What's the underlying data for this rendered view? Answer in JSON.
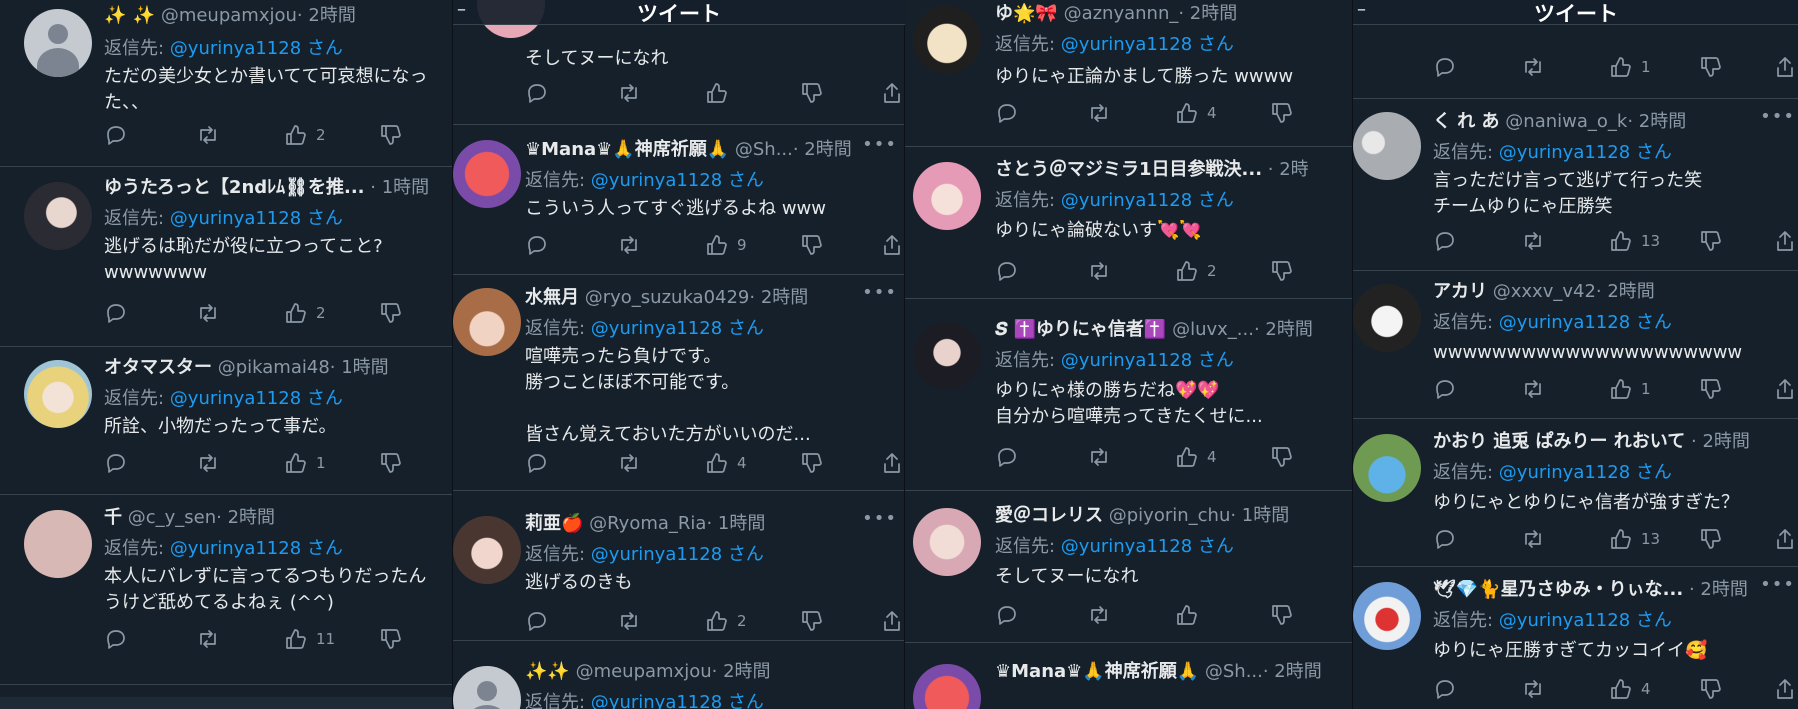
{
  "tweet_title": "ツイート",
  "back_glyph": "–",
  "colors": {
    "bg": "#15202b",
    "text": "#e7e9ea",
    "muted": "#8b98a5",
    "mention": "#1d9bf0",
    "divider": "#38444d"
  },
  "columns": [
    {
      "tweets": [
        {
          "name": "✨ ✨",
          "handle": "@meupamxjou",
          "time": "· 2時間",
          "reply_prefix": "返信先: ",
          "mention": "@yurinya1128 さん",
          "text": "ただの美少女とか書いてて可哀想になっ\nた、、",
          "likes": "2",
          "avatar": "default-avatar-icon"
        },
        {
          "name": "ゆうたろっと【2ndﾚﾑ⛓を推...",
          "handle": "",
          "time": "· 1時間",
          "reply_prefix": "返信先: ",
          "mention": "@yurinya1128 さん",
          "text": "逃げるは恥だが役に立つってこと?\nwwwwwww",
          "likes": "2",
          "avatar": "dark-hair-avatar"
        },
        {
          "name": "オタマスター",
          "handle": "@pikamai48",
          "time": "· 1時間",
          "reply_prefix": "返信先: ",
          "mention": "@yurinya1128 さん",
          "text": "所詮、小物だったって事だ。",
          "likes": "1",
          "avatar": "blonde-anime-avatar"
        },
        {
          "name": "千",
          "handle": "@c_y_sen",
          "time": "· 2時間",
          "reply_prefix": "返信先: ",
          "mention": "@yurinya1128 さん",
          "text": "本人にバレずに言ってるつもりだったん\nうけど舐めてるよねぇ (^^)",
          "likes": "11",
          "avatar": "pink-blank-avatar"
        }
      ]
    },
    {
      "tweets": [
        {
          "text": "そしてヌーになれ",
          "likes": "",
          "avatar": "pink-avatar"
        },
        {
          "name": "♛Mana♛🙏神席祈願🙏",
          "handle": "@Sh...",
          "time": "· 2時間",
          "reply_prefix": "返信先: ",
          "mention": "@yurinya1128 さん",
          "text": "こういう人ってすぐ逃げるよね www",
          "likes": "9",
          "avatar": "red-round-avatar"
        },
        {
          "name": "水無月",
          "handle": "@ryo_suzuka0429",
          "time": "· 2時間",
          "reply_prefix": "返信先: ",
          "mention": "@yurinya1128 さん",
          "text": "喧嘩売ったら負けです。\n勝つことほぼ不可能です。\n\n皆さん覚えておいた方がいいのだ...",
          "likes": "4",
          "avatar": "anime-girl-avatar"
        },
        {
          "name": "莉亜🍎",
          "handle": "@Ryoma_Ria",
          "time": "· 1時間",
          "reply_prefix": "返信先: ",
          "mention": "@yurinya1128 さん",
          "text": "逃げるのきも",
          "likes": "2",
          "avatar": "selfie-avatar"
        },
        {
          "name": "✨✨",
          "handle": "@meupamxjou",
          "time": "· 2時間",
          "reply_prefix": "返信先: ",
          "mention": "@yurinya1128 さん",
          "text": "",
          "likes": "",
          "avatar": "default-avatar-icon"
        }
      ]
    },
    {
      "tweets": [
        {
          "name": "ゆ🌟🎀",
          "handle": "@aznyannn_",
          "time": "· 2時間",
          "reply_prefix": "返信先: ",
          "mention": "@yurinya1128 さん",
          "text": "ゆりにゃ正論かまして勝った wwww",
          "likes": "4",
          "avatar": "chibi-avatar"
        },
        {
          "name": "さとう＠マジミラ1日目参戦決...",
          "handle": "",
          "time": "· 2時",
          "reply_prefix": "返信先: ",
          "mention": "@yurinya1128 さん",
          "text": "ゆりにゃ論破ないす💘💘",
          "likes": "2",
          "avatar": "pink-hair-avatar"
        },
        {
          "name": "𝑺 ✝️ゆりにゃ信者✝️",
          "handle": "@luvx_...",
          "time": "· 2時間",
          "reply_prefix": "返信先: ",
          "mention": "@yurinya1128 さん",
          "text": "ゆりにゃ様の勝ちだね💖💖\n自分から喧嘩売ってきたくせに...",
          "likes": "4",
          "avatar": "photo-avatar"
        },
        {
          "name": "愛＠コレリス",
          "handle": "@piyorin_chu",
          "time": "· 1時間",
          "reply_prefix": "返信先: ",
          "mention": "@yurinya1128 さん",
          "text": "そしてヌーになれ",
          "likes": "",
          "avatar": "pastel-avatar"
        },
        {
          "name": "♛Mana♛🙏神席祈願🙏",
          "handle": "@Sh...",
          "time": "· 2時間",
          "reply_prefix": "",
          "mention": "",
          "text": "",
          "likes": "",
          "avatar": "red-round-avatar"
        }
      ]
    },
    {
      "tweets": [
        {
          "text": "",
          "likes": "1",
          "avatar": ""
        },
        {
          "name": "く れ あ",
          "handle": "@naniwa_o_k",
          "time": "· 2時間",
          "reply_prefix": "返信先: ",
          "mention": "@yurinya1128 さん",
          "text": "言っただけ言って逃げて行った笑\nチームゆりにゃ圧勝笑",
          "likes": "13",
          "avatar": "gray-avatar"
        },
        {
          "name": "アカリ",
          "handle": "@xxxv_v42",
          "time": "· 2時間",
          "reply_prefix": "返信先: ",
          "mention": "@yurinya1128 さん",
          "text": "wwwwwwwwwwwwwwwwwwwww",
          "likes": "1",
          "avatar": "manga-avatar"
        },
        {
          "name": "かおり 追兎 ぱみりー れおいて",
          "handle": "",
          "time": "· 2時間",
          "reply_prefix": "返信先: ",
          "mention": "@yurinya1128 さん",
          "text": "ゆりにゃとゆりにゃ信者が強すぎた？",
          "likes": "13",
          "avatar": "drink-avatar"
        },
        {
          "name": "🕊💎🐈星乃さゆみ・りぃな...",
          "handle": "",
          "time": "· 2時間",
          "reply_prefix": "返信先: ",
          "mention": "@yurinya1128 さん",
          "text": "ゆりにゃ圧勝すぎてカッコイイ🥰",
          "likes": "4",
          "avatar": "blue-anime-avatar"
        }
      ]
    }
  ]
}
